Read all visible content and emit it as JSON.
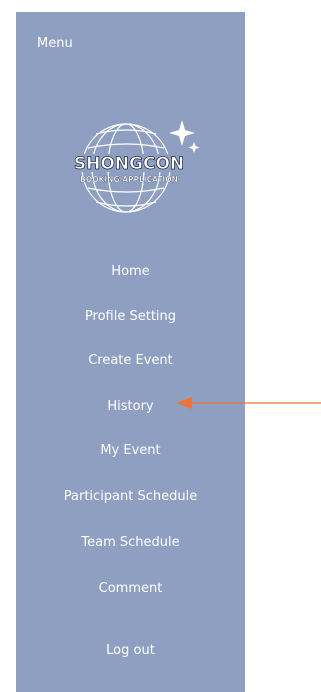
{
  "sidebar": {
    "menu_title": "Menu",
    "logo": {
      "name": "SHONGCON",
      "tagline": "BOOKING APPLICATION"
    },
    "items": [
      {
        "label": "Home"
      },
      {
        "label": "Profile Setting"
      },
      {
        "label": "Create Event"
      },
      {
        "label": "History"
      },
      {
        "label": "My Event"
      },
      {
        "label": "Participant Schedule"
      },
      {
        "label": "Team Schedule"
      },
      {
        "label": "Comment"
      }
    ],
    "logout_label": "Log out"
  },
  "colors": {
    "sidebar_bg": "#8f9fc2",
    "text": "#ffffff",
    "annotation_arrow": "#e8763a"
  },
  "icons": {
    "logo": "globe-logo-icon",
    "annotation": "arrow-left-icon"
  }
}
